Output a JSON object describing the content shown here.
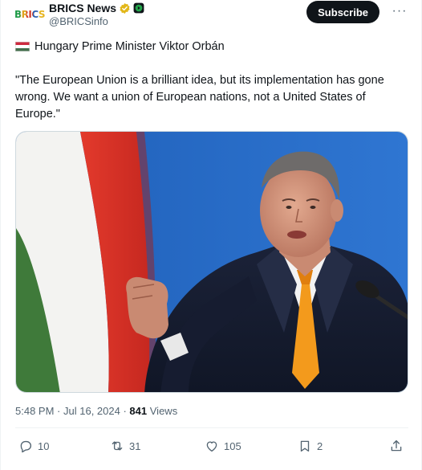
{
  "post": {
    "author_name": "BRICS News",
    "author_handle": "@BRICSinfo",
    "avatar_text": "BRICS",
    "subscribe_label": "Subscribe",
    "more_label": "···",
    "headline": "Hungary Prime Minister Viktor Orbán",
    "quote": "\"The European Union is a brilliant idea, but its implementation has gone wrong. We want a union of European nations, not a United States of Europe.\"",
    "time": "5:48 PM",
    "date": "Jul 16, 2024",
    "views_count": "841",
    "views_label": "Views"
  },
  "actions": {
    "replies": "10",
    "reposts": "31",
    "likes": "105",
    "bookmarks": "2"
  },
  "colors": {
    "accent": "#0f1419",
    "muted": "#536471",
    "verified_gold": "#e2b719",
    "flag_red": "#cd2a3e",
    "flag_white": "#ffffff",
    "flag_green": "#436f4d",
    "photo_background": "#2a6ec7"
  },
  "icons": [
    "gold-verified-icon",
    "green-affiliate-icon",
    "hungary-flag-icon",
    "reply-icon",
    "repost-icon",
    "like-icon",
    "bookmark-icon",
    "share-icon"
  ]
}
